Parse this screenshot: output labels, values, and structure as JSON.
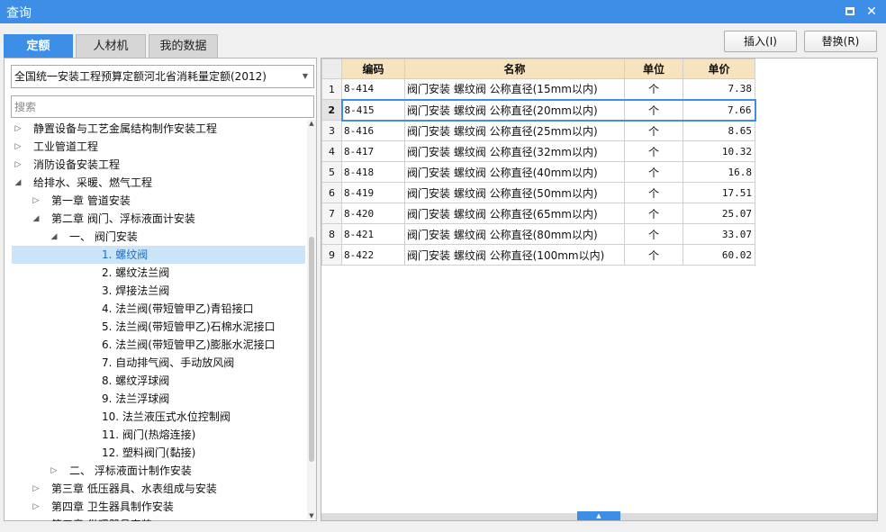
{
  "window": {
    "title": "查询",
    "maximize_icon": "maximize-icon",
    "close_glyph": "✕"
  },
  "tabs": [
    {
      "label": "定额",
      "active": true
    },
    {
      "label": "人材机",
      "active": false
    },
    {
      "label": "我的数据",
      "active": false
    }
  ],
  "buttons": {
    "insert": "插入(I)",
    "replace": "替换(R)"
  },
  "left": {
    "library_select": "全国统一安装工程预算定额河北省消耗量定额(2012)",
    "search_placeholder": "搜索",
    "tree": [
      {
        "label": "静置设备与工艺金属结构制作安装工程",
        "level": 0,
        "toggle": "collapsed"
      },
      {
        "label": "工业管道工程",
        "level": 0,
        "toggle": "collapsed"
      },
      {
        "label": "消防设备安装工程",
        "level": 0,
        "toggle": "collapsed"
      },
      {
        "label": "给排水、采暖、燃气工程",
        "level": 0,
        "toggle": "expanded"
      },
      {
        "label": "第一章 管道安装",
        "level": 1,
        "toggle": "collapsed"
      },
      {
        "label": "第二章 阀门、浮标液面计安装",
        "level": 1,
        "toggle": "expanded"
      },
      {
        "label": "一、 阀门安装",
        "level": 2,
        "toggle": "expanded"
      },
      {
        "label": "1.  螺纹阀",
        "level": 3,
        "toggle": "none",
        "selected": true
      },
      {
        "label": "2.  螺纹法兰阀",
        "level": 3,
        "toggle": "none"
      },
      {
        "label": "3.  焊接法兰阀",
        "level": 3,
        "toggle": "none"
      },
      {
        "label": "4.  法兰阀(带短管甲乙)青铅接口",
        "level": 3,
        "toggle": "none"
      },
      {
        "label": "5.  法兰阀(带短管甲乙)石棉水泥接口",
        "level": 3,
        "toggle": "none"
      },
      {
        "label": "6.  法兰阀(带短管甲乙)膨胀水泥接口",
        "level": 3,
        "toggle": "none"
      },
      {
        "label": "7.  自动排气阀、手动放风阀",
        "level": 3,
        "toggle": "none"
      },
      {
        "label": "8.  螺纹浮球阀",
        "level": 3,
        "toggle": "none"
      },
      {
        "label": "9.  法兰浮球阀",
        "level": 3,
        "toggle": "none"
      },
      {
        "label": "10.  法兰液压式水位控制阀",
        "level": 3,
        "toggle": "none"
      },
      {
        "label": "11.  阀门(热熔连接)",
        "level": 3,
        "toggle": "none"
      },
      {
        "label": "12.  塑料阀门(黏接)",
        "level": 3,
        "toggle": "none"
      },
      {
        "label": "二、 浮标液面计制作安装",
        "level": 2,
        "toggle": "collapsed"
      },
      {
        "label": "第三章 低压器具、水表组成与安装",
        "level": 1,
        "toggle": "collapsed"
      },
      {
        "label": "第四章 卫生器具制作安装",
        "level": 1,
        "toggle": "collapsed"
      },
      {
        "label": "第五章 供暖器具安装",
        "level": 1,
        "toggle": "collapsed"
      }
    ]
  },
  "grid": {
    "columns": [
      "编码",
      "名称",
      "单位",
      "单价"
    ],
    "rows": [
      {
        "n": "1",
        "code": "8-414",
        "name": "阀门安装 螺纹阀 公称直径(15mm以内)",
        "unit": "个",
        "price": "7.38"
      },
      {
        "n": "2",
        "code": "8-415",
        "name": "阀门安装 螺纹阀 公称直径(20mm以内)",
        "unit": "个",
        "price": "7.66",
        "selected": true
      },
      {
        "n": "3",
        "code": "8-416",
        "name": "阀门安装 螺纹阀 公称直径(25mm以内)",
        "unit": "个",
        "price": "8.65"
      },
      {
        "n": "4",
        "code": "8-417",
        "name": "阀门安装 螺纹阀 公称直径(32mm以内)",
        "unit": "个",
        "price": "10.32"
      },
      {
        "n": "5",
        "code": "8-418",
        "name": "阀门安装 螺纹阀 公称直径(40mm以内)",
        "unit": "个",
        "price": "16.8"
      },
      {
        "n": "6",
        "code": "8-419",
        "name": "阀门安装 螺纹阀 公称直径(50mm以内)",
        "unit": "个",
        "price": "17.51"
      },
      {
        "n": "7",
        "code": "8-420",
        "name": "阀门安装 螺纹阀 公称直径(65mm以内)",
        "unit": "个",
        "price": "25.07"
      },
      {
        "n": "8",
        "code": "8-421",
        "name": "阀门安装 螺纹阀 公称直径(80mm以内)",
        "unit": "个",
        "price": "33.07"
      },
      {
        "n": "9",
        "code": "8-422",
        "name": "阀门安装 螺纹阀 公称直径(100mm以内)",
        "unit": "个",
        "price": "60.02"
      }
    ]
  },
  "colors": {
    "accent": "#3d8ee6",
    "header_fill": "#f7e3bd",
    "selected_tree": "#cce4f7"
  }
}
